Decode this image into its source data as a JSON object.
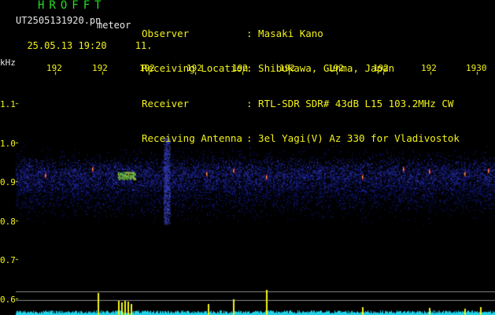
{
  "header": {
    "logo": "HROFFT",
    "filename": "UT2505131920.pn",
    "meteor_label": "meteor",
    "date_time": "25.05.13 19:20",
    "count": "11.",
    "labels": [
      "Observer",
      "Receiving Location",
      "Receiver",
      "Receiving Antenna"
    ],
    "values": [
      ": Masaki Kano",
      ": Shibukawa, Gunma, Japan",
      ": RTL-SDR SDR# 43dB L15 103.2MHz CW",
      ": 3el Yagi(V) Az 330 for Vladivostok"
    ]
  },
  "axes": {
    "y_unit": "kHz",
    "y_ticks": [
      "1.1",
      "1.0",
      "0.9",
      "0.8",
      "0.7",
      "0.6"
    ],
    "x_ticks": [
      "192",
      "192",
      "192",
      "192",
      "192",
      "192",
      "192",
      "192",
      "192",
      "1930"
    ]
  },
  "colors": {
    "text": "#f2f21a",
    "logo": "#22e022",
    "background": "#000000",
    "noise": "#1a2a9a",
    "spectrum": "#22d3e8",
    "signal": "#f2f21a"
  }
}
